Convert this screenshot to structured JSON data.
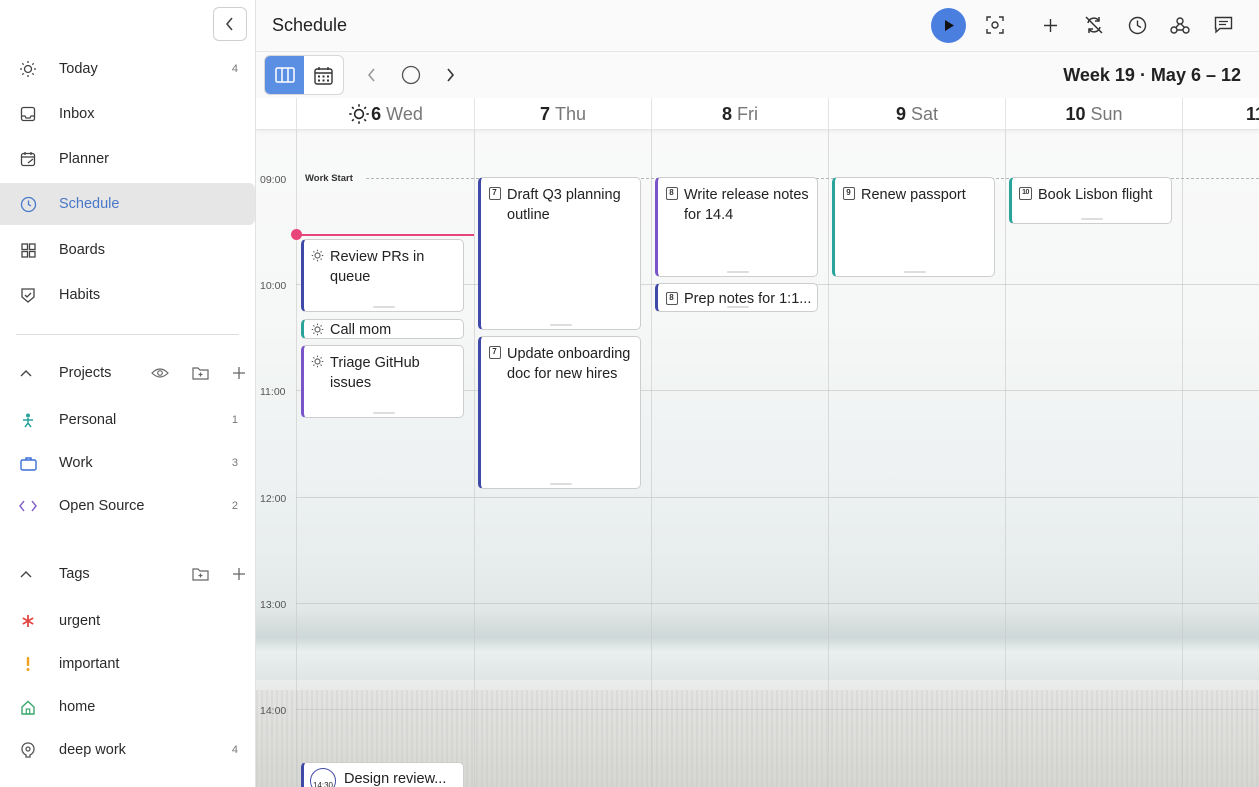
{
  "sidebar": {
    "nav": [
      {
        "label": "Today",
        "count": "4",
        "icon": "sun-icon"
      },
      {
        "label": "Inbox",
        "count": "",
        "icon": "inbox-icon"
      },
      {
        "label": "Planner",
        "count": "",
        "icon": "planner-icon"
      },
      {
        "label": "Schedule",
        "count": "",
        "icon": "clock-icon",
        "active": true
      },
      {
        "label": "Boards",
        "count": "",
        "icon": "grid-icon"
      },
      {
        "label": "Habits",
        "count": "",
        "icon": "habit-icon"
      }
    ],
    "projects": {
      "title": "Projects",
      "items": [
        {
          "label": "Personal",
          "count": "1",
          "icon": "person-icon",
          "color": "#2aa39a"
        },
        {
          "label": "Work",
          "count": "3",
          "icon": "briefcase-icon",
          "color": "#3c6fd6"
        },
        {
          "label": "Open Source",
          "count": "2",
          "icon": "code-icon",
          "color": "#7a55c9"
        }
      ]
    },
    "tags": {
      "title": "Tags",
      "items": [
        {
          "label": "urgent",
          "count": "",
          "icon": "asterisk-icon",
          "color": "#e04848"
        },
        {
          "label": "important",
          "count": "",
          "icon": "exclamation-icon",
          "color": "#f0a020"
        },
        {
          "label": "home",
          "count": "",
          "icon": "home-icon",
          "color": "#3aa76d"
        },
        {
          "label": "deep work",
          "count": "4",
          "icon": "focus-icon",
          "color": "#555555"
        }
      ]
    }
  },
  "header": {
    "title": "Schedule",
    "week_title": "Week 19 · May 6 – 12"
  },
  "days": [
    {
      "num": "6",
      "name": "Wed",
      "today": true
    },
    {
      "num": "7",
      "name": "Thu"
    },
    {
      "num": "8",
      "name": "Fri"
    },
    {
      "num": "9",
      "name": "Sat"
    },
    {
      "num": "10",
      "name": "Sun"
    },
    {
      "num": "11",
      "name": ""
    }
  ],
  "hours": [
    "09:00",
    "10:00",
    "11:00",
    "12:00",
    "13:00",
    "14:00"
  ],
  "work_start_label": "Work Start",
  "events": {
    "review_prs": {
      "title": "Review PRs in queue",
      "color": "#3f4aa8"
    },
    "call_mom": {
      "title": "Call mom",
      "color": "#2aa39a"
    },
    "triage": {
      "title": "Triage GitHub issues",
      "color": "#7a55c9"
    },
    "draft_q3": {
      "title": "Draft Q3 planning outline",
      "date": "7",
      "color": "#3f4aa8"
    },
    "onboarding": {
      "title": "Update onboarding doc for new hires",
      "date": "7",
      "color": "#3f4aa8"
    },
    "release_notes": {
      "title": "Write release notes for 14.4",
      "date": "8",
      "color": "#7a55c9"
    },
    "prep_notes": {
      "title": "Prep notes for 1:1...",
      "date": "8",
      "color": "#3f4aa8"
    },
    "passport": {
      "title": "Renew passport",
      "date": "9",
      "color": "#2aa39a"
    },
    "lisbon": {
      "title": "Book Lisbon flight",
      "date": "10",
      "color": "#2aa39a"
    },
    "design_review": {
      "title": "Design review...",
      "time": "14:30",
      "color": "#3f4aa8"
    }
  },
  "colors": {
    "accent": "#4a7fe0",
    "now_line": "#e8457a"
  }
}
